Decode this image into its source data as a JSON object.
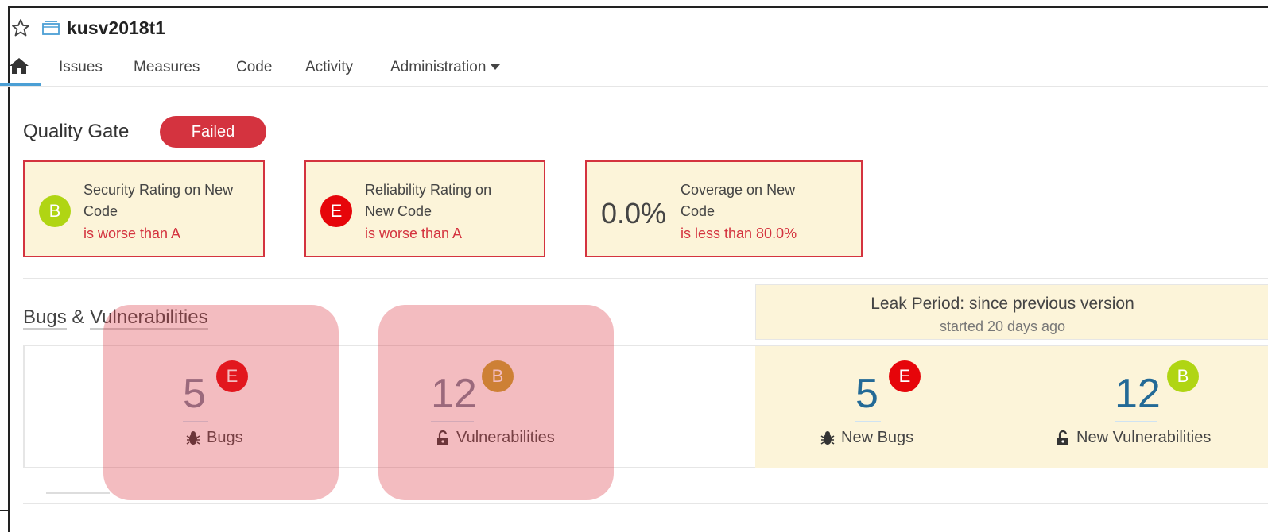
{
  "project": {
    "name": "kusv2018t1"
  },
  "nav": {
    "items": [
      "Issues",
      "Measures",
      "Code",
      "Activity",
      "Administration"
    ]
  },
  "quality_gate": {
    "title": "Quality Gate",
    "status": "Failed",
    "conditions": [
      {
        "rating": "B",
        "rating_color": "#b0d513",
        "label": "Security Rating on New Code",
        "line1": "Security Rating on New",
        "line2": "Code",
        "error": "is worse than A"
      },
      {
        "rating": "E",
        "rating_color": "#e6050a",
        "label": "Reliability Rating on New Code",
        "line1": "Reliability Rating on",
        "line2": "New Code",
        "error": "is worse than A"
      },
      {
        "value": "0.0%",
        "label": "Coverage on New Code",
        "line1": "Coverage on New",
        "line2": "Code",
        "error": "is less than 80.0%"
      }
    ]
  },
  "bugs_vulns": {
    "title_part1": "Bugs",
    "title_amp": "&",
    "title_part2": "Vulnerabilities",
    "leak_period": {
      "title": "Leak Period: since previous version",
      "subtitle": "started 20 days ago"
    },
    "metrics": [
      {
        "value": "5",
        "rating": "E",
        "rating_color": "#e6050a",
        "label": "Bugs",
        "icon": "bug-icon"
      },
      {
        "value": "12",
        "rating": "B",
        "rating_color": "#b0d513",
        "label": "Vulnerabilities",
        "icon": "lock-icon"
      },
      {
        "value": "5",
        "rating": "E",
        "rating_color": "#e6050a",
        "label": "New Bugs",
        "icon": "bug-icon"
      },
      {
        "value": "12",
        "rating": "B",
        "rating_color": "#b0d513",
        "label": "New Vulnerabilities",
        "icon": "lock-icon"
      }
    ]
  },
  "colors": {
    "accent": "#4b9fd5",
    "error": "#d4333f",
    "leak_bg": "#fcf4d9",
    "value_blue": "#236a97"
  }
}
